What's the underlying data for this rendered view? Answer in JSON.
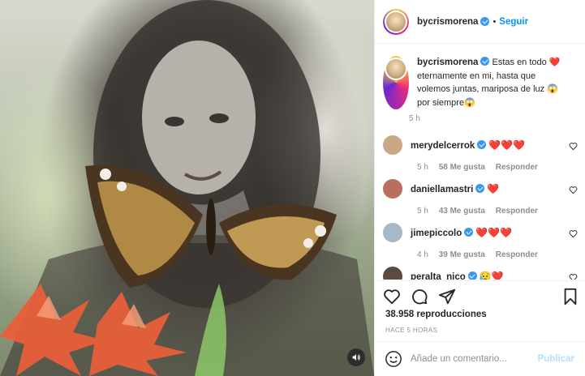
{
  "post": {
    "author": "bycrismorena",
    "follow_label": "Seguir",
    "separator": "•",
    "caption": "Estas en todo ❤️ eternamente en mi, hasta que volemos juntas, mariposa de luz 😱 por siempre😱",
    "caption_time": "5 h"
  },
  "comments": [
    {
      "user": "merydelcerrok",
      "text": "❤️❤️❤️",
      "time": "5 h",
      "likes": "58 Me gusta",
      "reply": "Responder",
      "avatar_color": "#c9a886"
    },
    {
      "user": "daniellamastri",
      "text": "❤️",
      "time": "5 h",
      "likes": "43 Me gusta",
      "reply": "Responder",
      "avatar_color": "#b86f5e"
    },
    {
      "user": "jimepiccolo",
      "text": "❤️❤️❤️",
      "time": "4 h",
      "likes": "39 Me gusta",
      "reply": "Responder",
      "avatar_color": "#a7b8c6"
    },
    {
      "user": "peralta_nico",
      "text": "😥❤️",
      "avatar_color": "#5a4a40"
    }
  ],
  "stats": {
    "views": "38.958 reproducciones",
    "time_ago": "HACE 5 HORAS"
  },
  "comment_box": {
    "placeholder": "Añade un comentario...",
    "publish_label": "Publicar"
  },
  "icons": {
    "like": "heart-icon",
    "comment": "comment-icon",
    "share": "share-icon",
    "save": "bookmark-icon",
    "emoji": "emoji-icon",
    "sound": "speaker-icon"
  },
  "colors": {
    "accent": "#0095f6",
    "verified": "#3897f0",
    "heart": "#ed4956",
    "muted": "#8e8e8e"
  }
}
